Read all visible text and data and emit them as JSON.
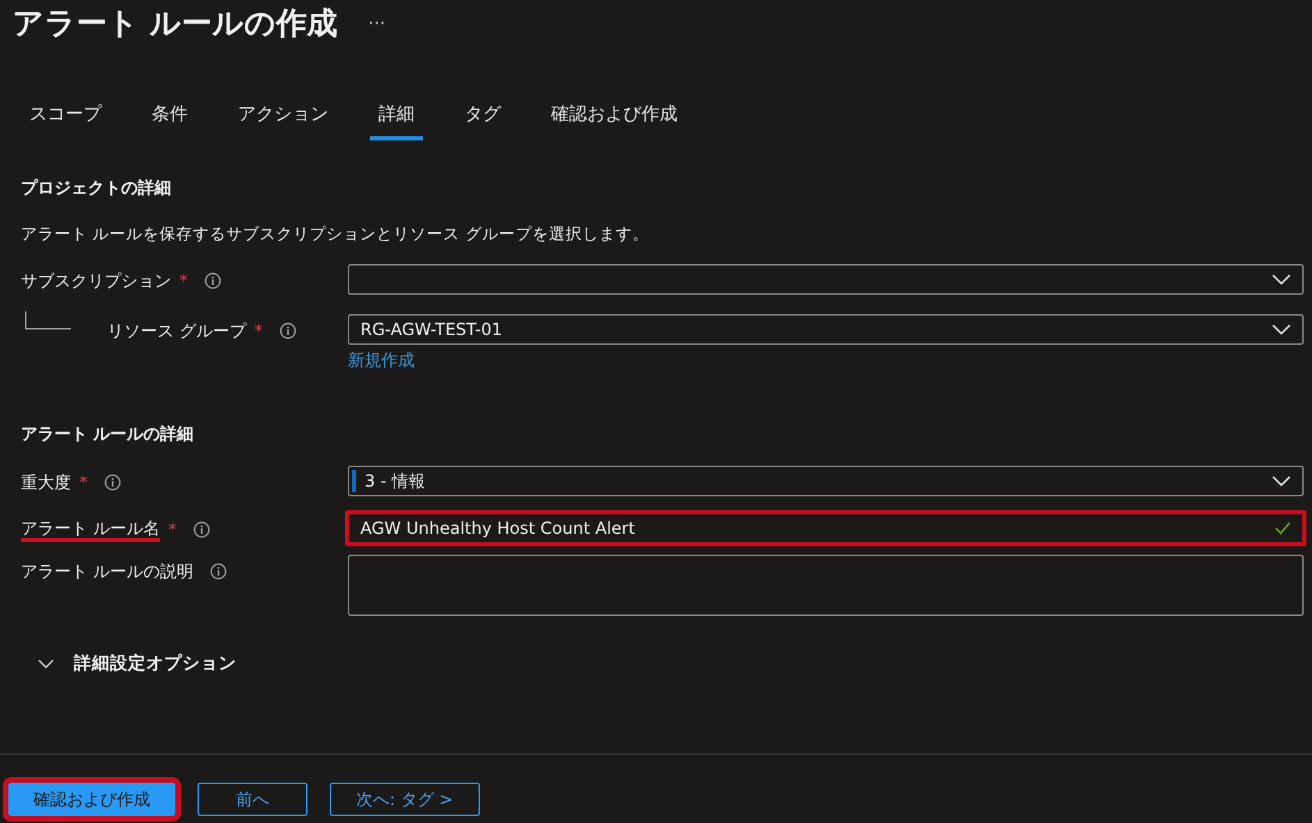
{
  "header": {
    "title": "アラート ルールの作成",
    "more": "···"
  },
  "tabs": [
    {
      "label": "スコープ",
      "selected": false
    },
    {
      "label": "条件",
      "selected": false
    },
    {
      "label": "アクション",
      "selected": false
    },
    {
      "label": "詳細",
      "selected": true
    },
    {
      "label": "タグ",
      "selected": false
    },
    {
      "label": "確認および作成",
      "selected": false
    }
  ],
  "sections": [
    {
      "heading": "プロジェクトの詳細",
      "description": "アラート ルールを保存するサブスクリプションとリソース グループを選択します。",
      "rows": [
        {
          "kind": "dropdown",
          "label": "サブスクリプション",
          "required": "*",
          "nested": false,
          "underlined": false,
          "highlighted": false,
          "value": ""
        },
        {
          "kind": "dropdown",
          "label": "リソース グループ",
          "required": "*",
          "nested": true,
          "underlined": false,
          "highlighted": false,
          "value": "RG-AGW-TEST-01",
          "link": "新規作成"
        }
      ]
    },
    {
      "heading": "アラート ルールの詳細",
      "rows": [
        {
          "kind": "dropdown",
          "label": "重大度",
          "required": "*",
          "nested": false,
          "underlined": false,
          "highlighted": false,
          "value": "3 - 情報",
          "color": "#0f6cbd"
        },
        {
          "kind": "text",
          "label": "アラート ルール名",
          "required": "*",
          "nested": false,
          "underlined": true,
          "highlighted": true,
          "value": "AGW Unhealthy Host Count Alert",
          "valid": true
        },
        {
          "kind": "textarea",
          "label": "アラート ルールの説明",
          "nested": false,
          "underlined": false,
          "highlighted": false,
          "value": ""
        }
      ]
    }
  ],
  "advanced": {
    "label": "詳細設定オプション",
    "expanded": false
  },
  "footer": {
    "buttons": [
      {
        "label": "確認および作成",
        "kind": "primary",
        "highlighted": true
      },
      {
        "label": "前へ",
        "kind": "secondary",
        "highlighted": false
      },
      {
        "label": "次へ: タグ >",
        "kind": "secondary",
        "highlighted": false
      }
    ]
  }
}
